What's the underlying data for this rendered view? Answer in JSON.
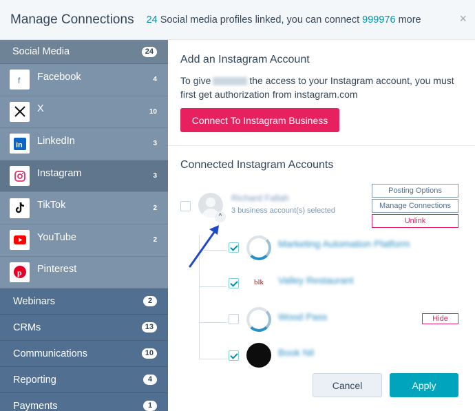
{
  "header": {
    "title": "Manage Connections",
    "linked_count": "24",
    "linked_text": "Social media profiles linked, you can connect",
    "more_count": "999976",
    "more_text": "more",
    "close_glyph": "×"
  },
  "sidebar": {
    "section_label": "Social Media",
    "section_count": "24",
    "networks": [
      {
        "label": "Facebook",
        "count": "4",
        "icon": "facebook-icon"
      },
      {
        "label": "X",
        "count": "10",
        "icon": "x-icon"
      },
      {
        "label": "LinkedIn",
        "count": "3",
        "icon": "linkedin-icon"
      },
      {
        "label": "Instagram",
        "count": "3",
        "icon": "instagram-icon"
      },
      {
        "label": "TikTok",
        "count": "2",
        "icon": "tiktok-icon"
      },
      {
        "label": "YouTube",
        "count": "2",
        "icon": "youtube-icon"
      },
      {
        "label": "Pinterest",
        "count": "",
        "icon": "pinterest-icon"
      }
    ],
    "categories": [
      {
        "label": "Webinars",
        "count": "2"
      },
      {
        "label": "CRMs",
        "count": "13"
      },
      {
        "label": "Communications",
        "count": "10"
      },
      {
        "label": "Reporting",
        "count": "4"
      },
      {
        "label": "Payments",
        "count": "1"
      }
    ]
  },
  "main": {
    "add_title": "Add an Instagram Account",
    "add_desc_before": "To give",
    "add_desc_after": "the access to your Instagram account, you must first get authorization from instagram.com",
    "connect_button": "Connect To Instagram Business",
    "connected_title": "Connected Instagram Accounts",
    "user": {
      "name": "Richard Fallah",
      "sub": "3 business account(s) selected",
      "expander_glyph": "^",
      "posting_options": "Posting Options",
      "manage_connections": "Manage Connections",
      "unlink": "Unlink"
    },
    "accounts": [
      {
        "name": "Marketing Automation Platform",
        "checked": true,
        "logo": "ring-logo"
      },
      {
        "name": "Valley Restaurant",
        "checked": true,
        "logo": "text-logo",
        "logo_text": "blk"
      },
      {
        "name": "Wood Pass",
        "checked": false,
        "logo": "ring-logo",
        "hide": "Hide"
      },
      {
        "name": "Book Nil",
        "checked": true,
        "logo": "dark-logo"
      }
    ],
    "cancel": "Cancel",
    "apply": "Apply"
  },
  "colors": {
    "brand_pink": "#e7205f",
    "accent_teal": "#00a4bd",
    "sidebar_dark": "#516f90",
    "sidebar_light": "#7c93a9",
    "arrow_blue": "#1f49c9"
  }
}
